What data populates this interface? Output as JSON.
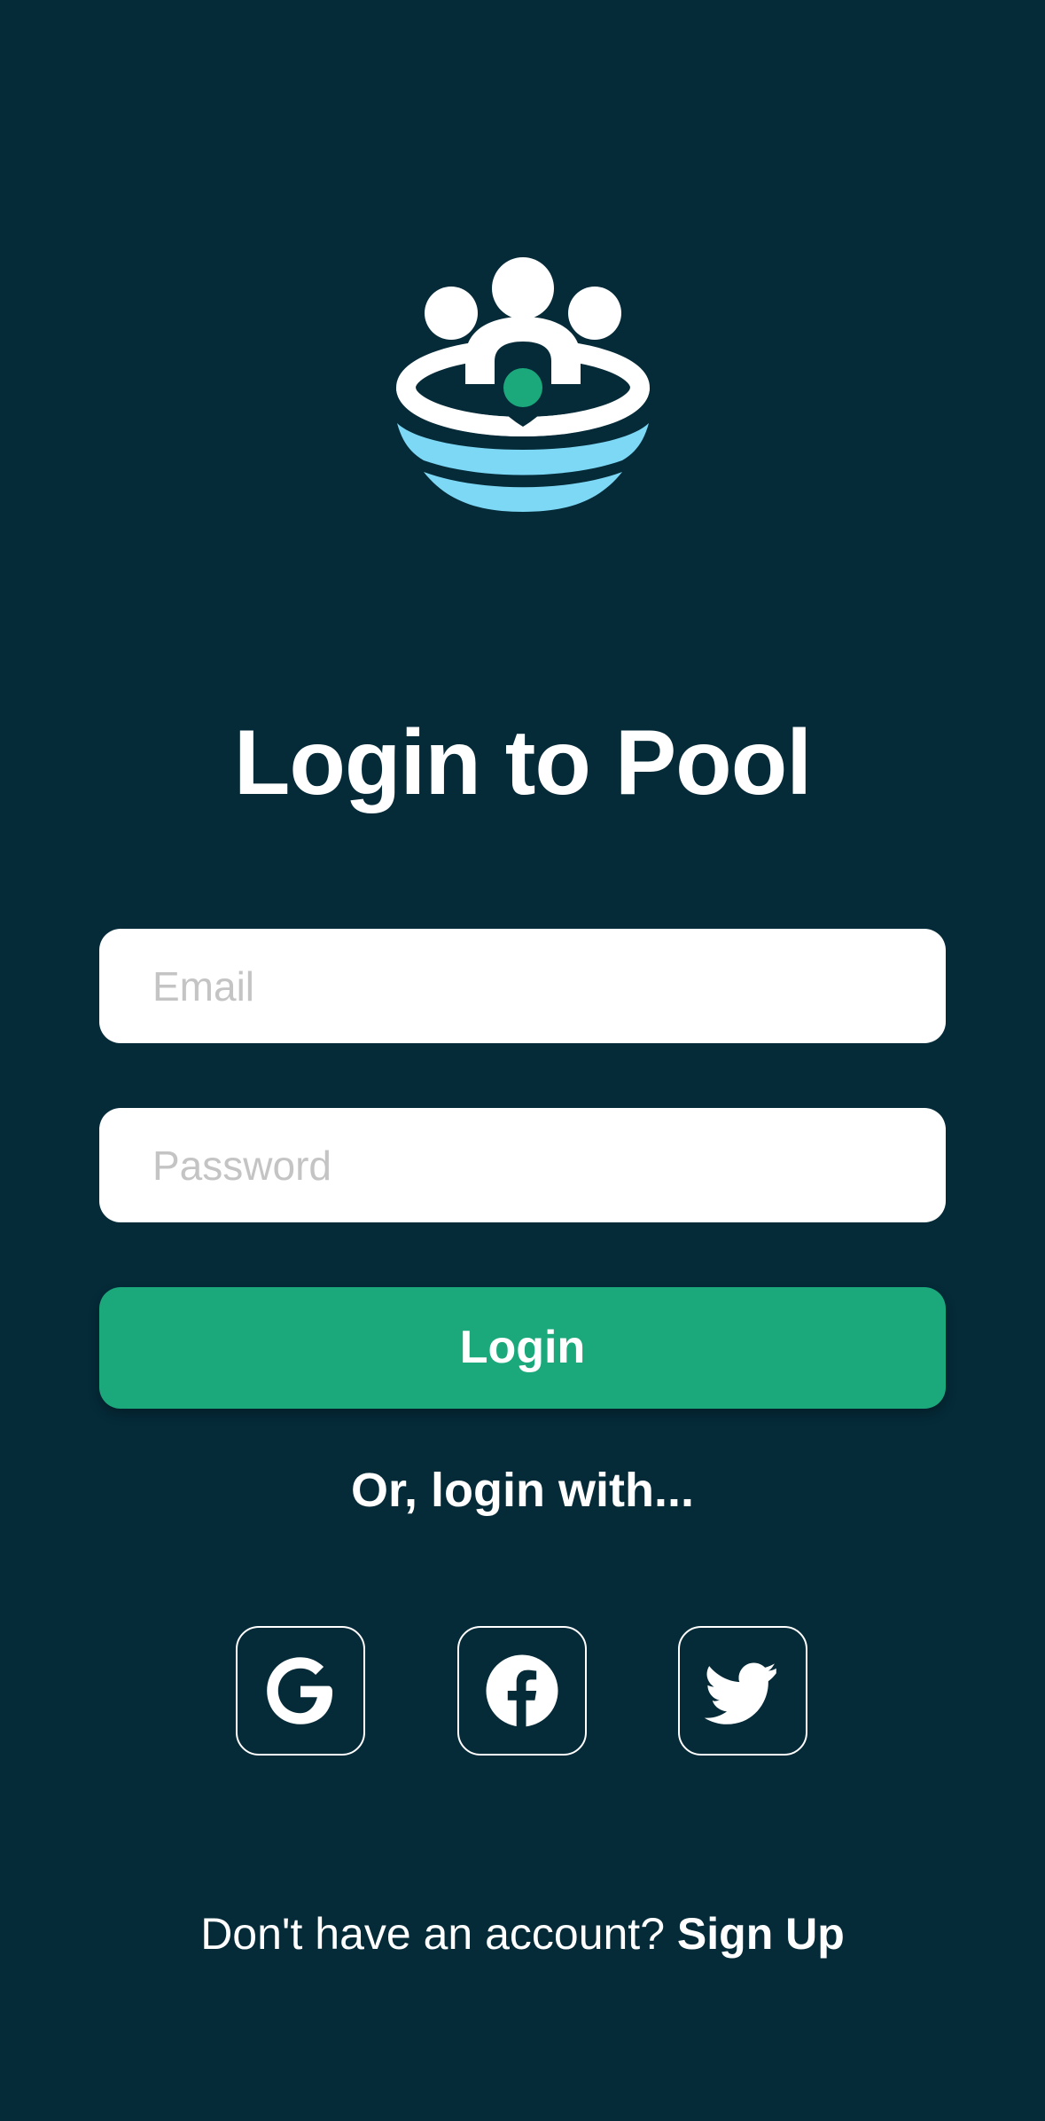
{
  "colors": {
    "background": "#052a38",
    "accent": "#1ba97c",
    "logo_water": "#7dd8f5",
    "text_on_dark": "#ffffff",
    "placeholder": "#c4c4c4"
  },
  "logo": {
    "icon": "pool-people-logo-icon"
  },
  "title": "Login to Pool",
  "form": {
    "email_placeholder": "Email",
    "email_value": "",
    "password_placeholder": "Password",
    "password_value": "",
    "login_label": "Login"
  },
  "alt_login_text": "Or, login with...",
  "social": [
    {
      "icon": "google-icon"
    },
    {
      "icon": "facebook-icon"
    },
    {
      "icon": "twitter-icon"
    }
  ],
  "footer": {
    "prompt": "Don't have an account?",
    "signup_label": "Sign Up"
  }
}
